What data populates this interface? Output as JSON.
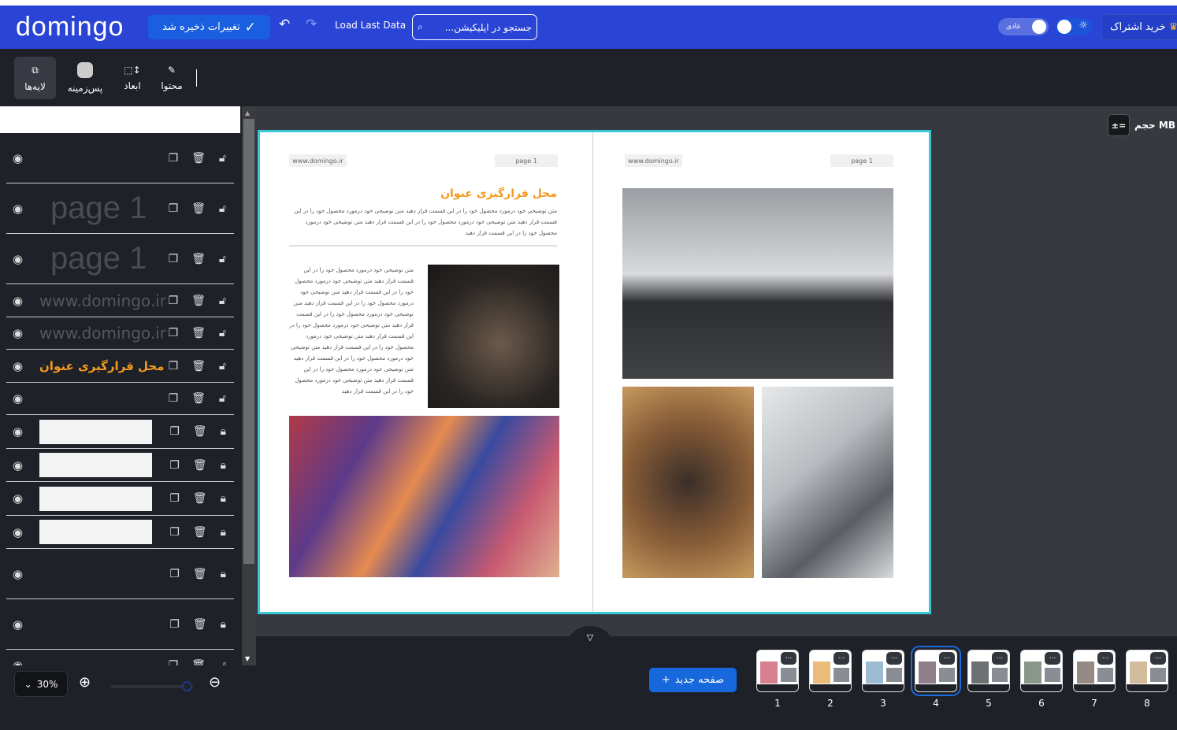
{
  "header": {
    "logo": "domingo",
    "saved_label": "تغییرات ذخیره شد",
    "load_last": "Load Last Data",
    "search_placeholder": "جستجو در اپلیکیشن...",
    "mode_label": "عادی",
    "subscribe_label": "خرید اشتراک",
    "bg_color": "#2a44d6"
  },
  "toolbar": {
    "items": [
      {
        "label": "لایه‌ها",
        "icon": "layers-icon",
        "active": true
      },
      {
        "label": "پس‌زمینه",
        "icon": "background-icon"
      },
      {
        "label": "ابعاد",
        "icon": "dimensions-icon"
      },
      {
        "label": "محتوا",
        "icon": "edit-icon"
      }
    ]
  },
  "layers": [
    {
      "type": "empty"
    },
    {
      "type": "page",
      "text": "page 1"
    },
    {
      "type": "page",
      "text": "page 1"
    },
    {
      "type": "url",
      "text": "www.domingo.ir"
    },
    {
      "type": "url",
      "text": "www.domingo.ir"
    },
    {
      "type": "title",
      "text": "محل قرارگیری عنوان"
    },
    {
      "type": "empty"
    },
    {
      "type": "image",
      "locked": true
    },
    {
      "type": "image",
      "locked": true
    },
    {
      "type": "image",
      "locked": true
    },
    {
      "type": "image",
      "locked": true
    },
    {
      "type": "empty",
      "locked": true
    },
    {
      "type": "empty",
      "locked": true
    },
    {
      "type": "empty"
    }
  ],
  "canvas": {
    "size_label": "حجم MB",
    "left_page": {
      "url": "www.domingo.ir",
      "page": "page 1",
      "title": "محل قرارگیری عنوان",
      "intro": "متن توضیحی خود درمورد محصول خود را در این قسمت قرار دهید  متن توضیحی خود درمورد محصول خود را در این قسمت قرار دهید  متن توضیحی خود درمورد محصول خود را در این قسمت قرار دهید  متن توضیحی خود درمورد محصول خود را در این قسمت قرار دهید",
      "body": "متن توضیحی خود درمورد محصول خود را در این قسمت قرار دهید  متن توضیحی خود درمورد محصول خود را در این قسمت قرار دهید  متن توضیحی خود درمورد محصول خود را در این قسمت قرار دهید  متن توضیحی خود درمورد محصول خود را در این قسمت قرار دهید  متن توضیحی خود درمورد محصول خود را در این قسمت قرار دهید  متن توضیحی خود درمورد محصول خود را در این قسمت قرار دهید  متن توضیحی خود درمورد محصول خود را در این قسمت قرار دهید  متن توضیحی خود درمورد محصول خود را در این قسمت قرار دهید  متن توضیحی خود درمورد محصول خود را در این قسمت قرار دهید"
    },
    "right_page": {
      "url": "www.domingo.ir",
      "page": "page 1"
    }
  },
  "bottom": {
    "zoom": "30%",
    "zoom_level": 0.95,
    "new_page_label": "صفحه جدید",
    "pages": [
      "1",
      "2",
      "3",
      "4",
      "5",
      "6",
      "7",
      "8"
    ],
    "selected_page": "4",
    "more": "..."
  }
}
